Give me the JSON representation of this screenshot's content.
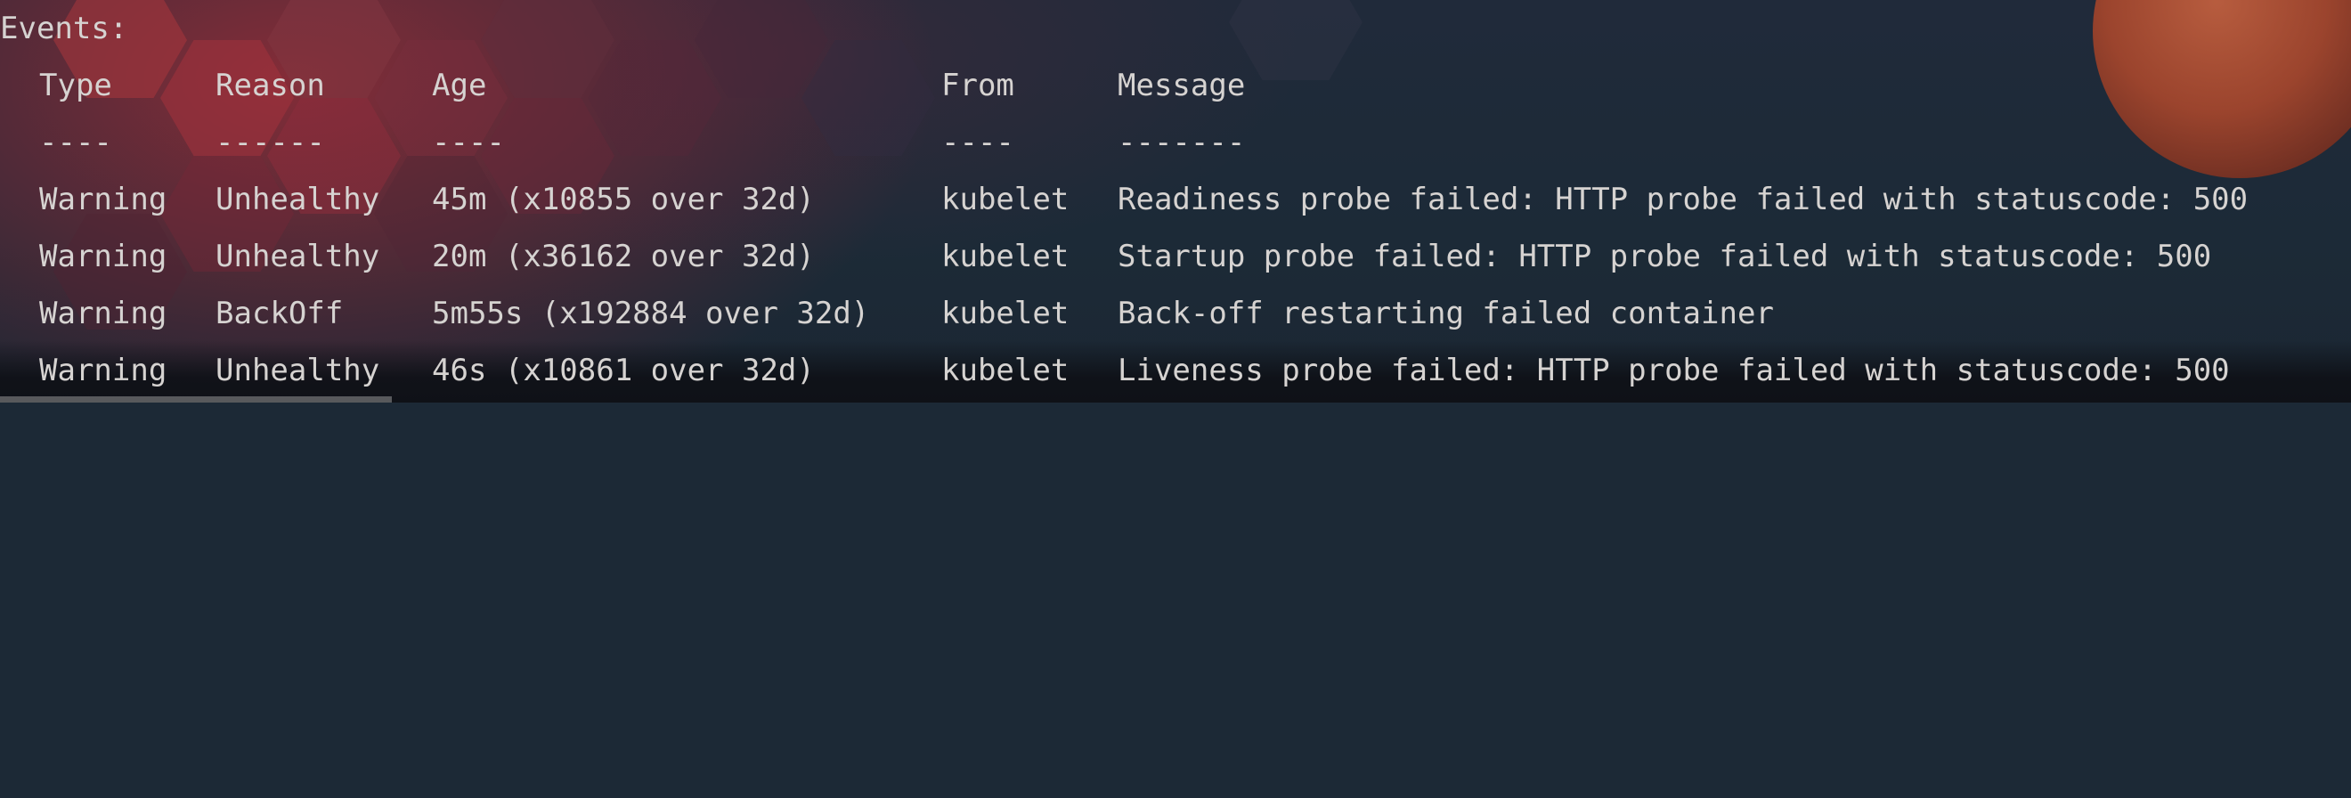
{
  "terminal": {
    "heading": "Events:",
    "columns": {
      "type": "Type",
      "reason": "Reason",
      "age": "Age",
      "from": "From",
      "message": "Message"
    },
    "separators": {
      "type": "----",
      "reason": "------",
      "age": "----",
      "from": "----",
      "message": "-------"
    },
    "events": [
      {
        "type": "Warning",
        "reason": "Unhealthy",
        "age": "45m (x10855 over 32d)",
        "from": "kubelet",
        "message": "Readiness probe failed: HTTP probe failed with statuscode: 500"
      },
      {
        "type": "Warning",
        "reason": "Unhealthy",
        "age": "20m (x36162 over 32d)",
        "from": "kubelet",
        "message": "Startup probe failed: HTTP probe failed with statuscode: 500"
      },
      {
        "type": "Warning",
        "reason": "BackOff",
        "age": "5m55s (x192884 over 32d)",
        "from": "kubelet",
        "message": "Back-off restarting failed container"
      },
      {
        "type": "Warning",
        "reason": "Unhealthy",
        "age": "46s (x10861 over 32d)",
        "from": "kubelet",
        "message": "Liveness probe failed: HTTP probe failed with statuscode: 500"
      }
    ]
  }
}
